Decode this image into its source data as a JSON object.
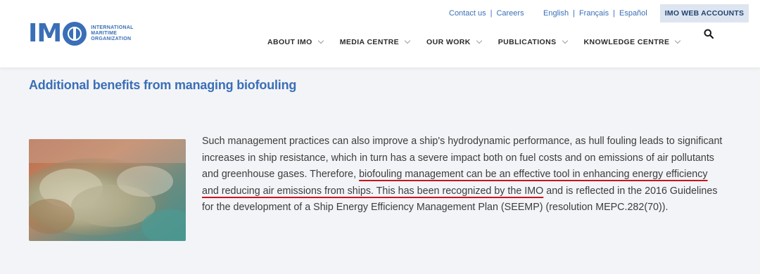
{
  "header": {
    "logo": {
      "mark": "IM",
      "text_lines": [
        "INTERNATIONAL",
        "MARITIME",
        "ORGANIZATION"
      ]
    },
    "top_links": [
      "Contact us",
      "Careers"
    ],
    "languages": [
      "English",
      "Français",
      "Español"
    ],
    "accounts_button": "IMO WEB ACCOUNTS",
    "nav": [
      "ABOUT IMO",
      "MEDIA CENTRE",
      "OUR WORK",
      "PUBLICATIONS",
      "KNOWLEDGE CENTRE"
    ],
    "search_icon": "search-icon"
  },
  "main": {
    "title": "Additional benefits from managing biofouling",
    "paragraph": {
      "before": "Such management practices can also improve a ship's hydrodynamic performance, as hull fouling leads to significant increases in ship resistance, which in turn has a severe impact both on fuel costs and on emissions of air pollutants and greenhouse gases. Therefore, ",
      "highlight": "biofouling management can be an effective tool in enhancing energy efficiency and reducing air emissions from ships. This has been recognized by the IMO",
      "after": " and is reflected in the 2016 Guidelines for the development of a Ship Energy Efficiency Management Plan (SEEMP) (resolution MEPC.282(70))."
    }
  },
  "colors": {
    "brand_blue": "#3a6fb7",
    "highlight_underline": "#c8141e",
    "page_background": "#f3f4f7"
  }
}
